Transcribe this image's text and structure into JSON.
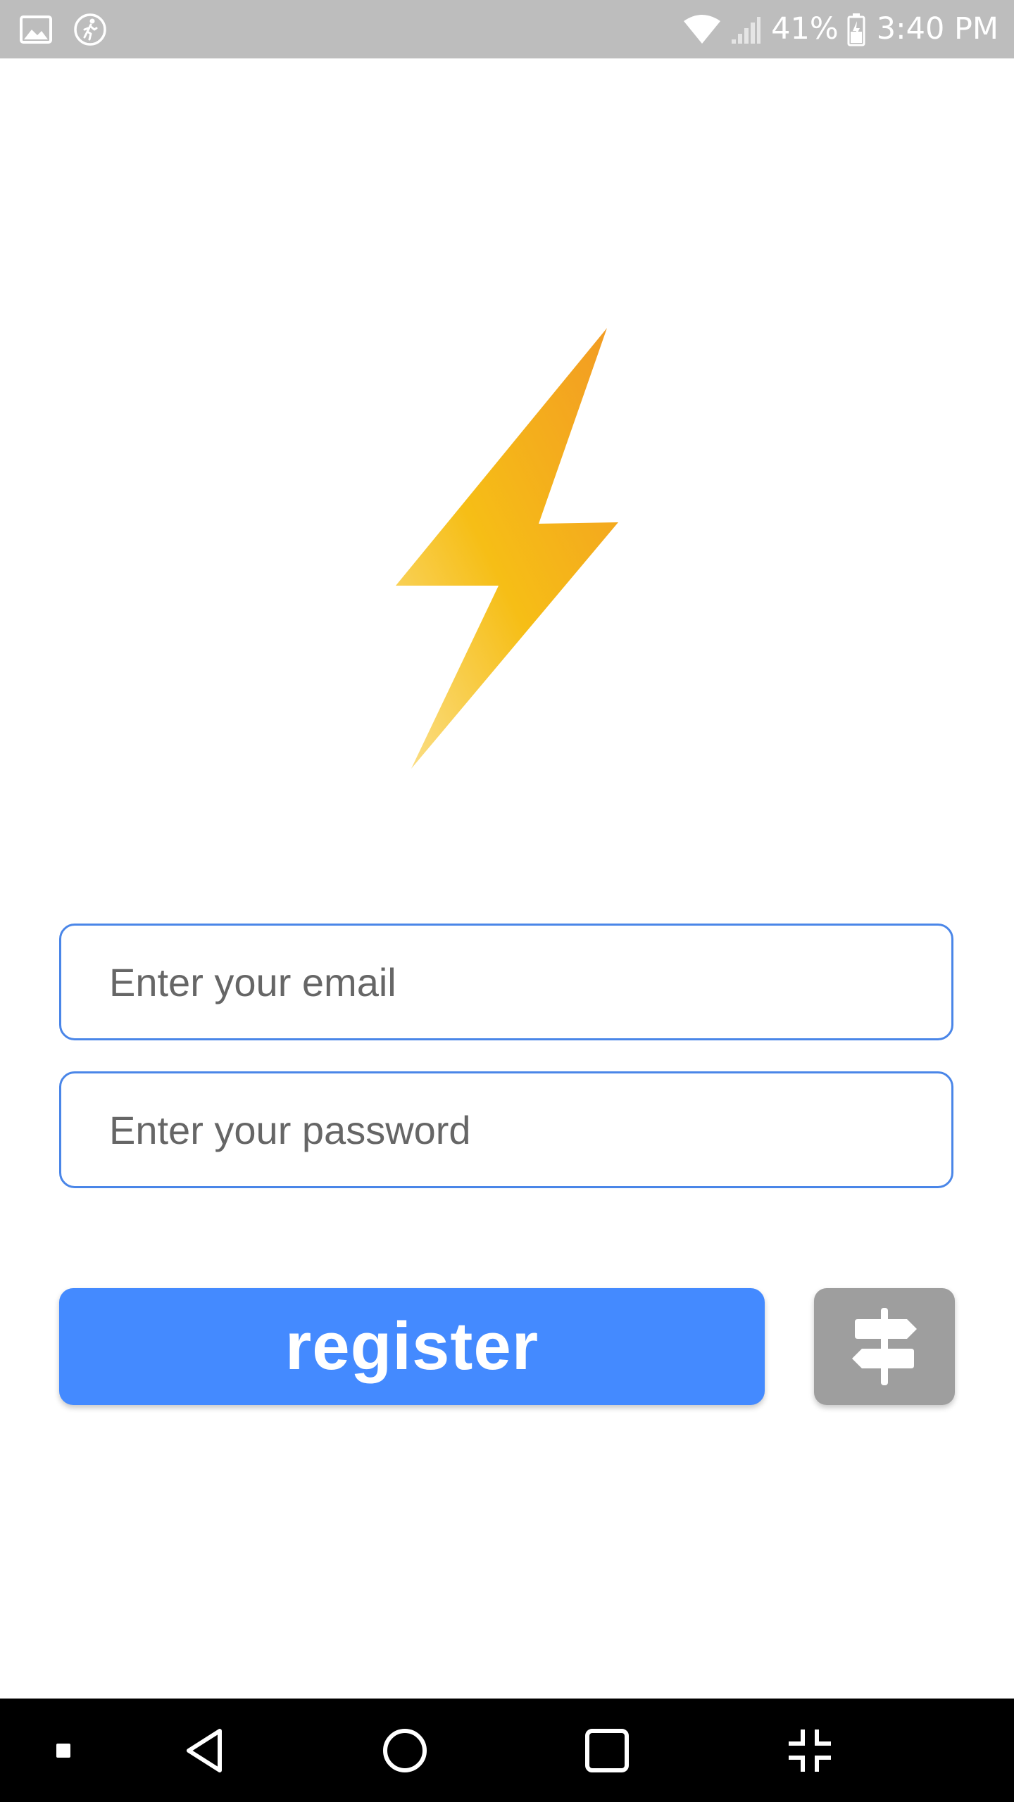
{
  "status_bar": {
    "battery_percent": "41%",
    "time": "3:40 PM",
    "left_icons": [
      "image-icon",
      "walking-icon"
    ],
    "right_icons": [
      "wifi-icon",
      "signal-icon",
      "battery-icon"
    ]
  },
  "logo": {
    "icon": "lightning-bolt-icon",
    "colors": [
      "#f9d97a",
      "#f6be16",
      "#f29f23"
    ]
  },
  "form": {
    "email": {
      "value": "",
      "placeholder": "Enter your email"
    },
    "password": {
      "value": "",
      "placeholder": "Enter your password"
    },
    "register_label": "register",
    "secondary_button_icon": "signpost-icon"
  },
  "colors": {
    "accent": "#448aff",
    "input_border": "#4a86e8",
    "secondary_button": "#9e9e9e",
    "status_bar": "#bdbdbd",
    "nav_bar": "#000000"
  },
  "nav_bar": {
    "buttons": [
      "menu-dot-icon",
      "back-icon",
      "home-icon",
      "recents-icon",
      "collapse-icon"
    ]
  }
}
